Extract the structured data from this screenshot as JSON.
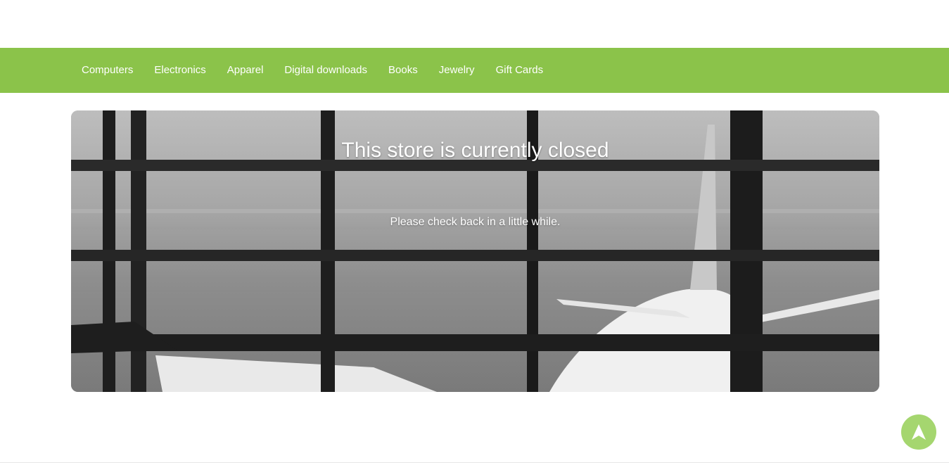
{
  "header_menu": {
    "items": [
      {
        "label": "Computers"
      },
      {
        "label": "Electronics"
      },
      {
        "label": "Apparel"
      },
      {
        "label": "Digital downloads"
      },
      {
        "label": "Books"
      },
      {
        "label": "Jewelry"
      },
      {
        "label": "Gift Cards"
      }
    ]
  },
  "closed_notice": {
    "title": "This store is currently closed",
    "message": "Please check back in a little while."
  },
  "scroll_top": {
    "icon": "arrow-up-icon"
  },
  "colors": {
    "menu_bar": "#8bc34a",
    "scroll_button": "#a5d66f"
  }
}
